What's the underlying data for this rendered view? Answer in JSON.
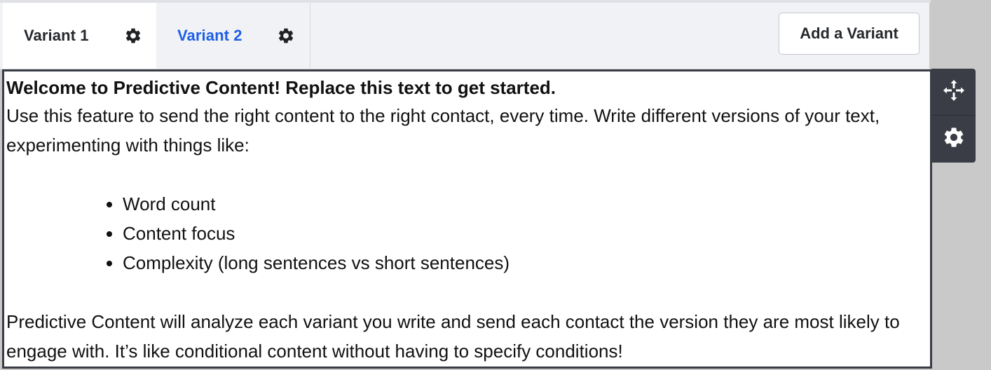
{
  "tabs": [
    {
      "label": "Variant 1",
      "state": "selected",
      "icon": "gear-icon"
    },
    {
      "label": "Variant 2",
      "state": "unselected",
      "icon": "gear-icon"
    }
  ],
  "toolbar": {
    "add_variant_label": "Add a Variant"
  },
  "editor": {
    "heading": "Welcome to Predictive Content! Replace this text to get started.",
    "intro": "Use this feature to send the right content to the right contact, every time. Write different versions of your text, experimenting with things like:",
    "list_items": [
      "Word count",
      "Content focus",
      "Complexity (long sentences vs short sentences)"
    ],
    "closing": "Predictive Content will analyze each variant you write and send each contact the version they are most likely to engage with. It’s like conditional content without having to specify conditions!"
  },
  "tools": {
    "move_icon": "move-arrows-icon",
    "settings_icon": "gear-icon"
  },
  "colors": {
    "active_tab_text": "#26292d",
    "inactive_tab_text": "#1e5fe6",
    "panel_dark": "#3a3d45",
    "background": "#c9c9c9"
  }
}
